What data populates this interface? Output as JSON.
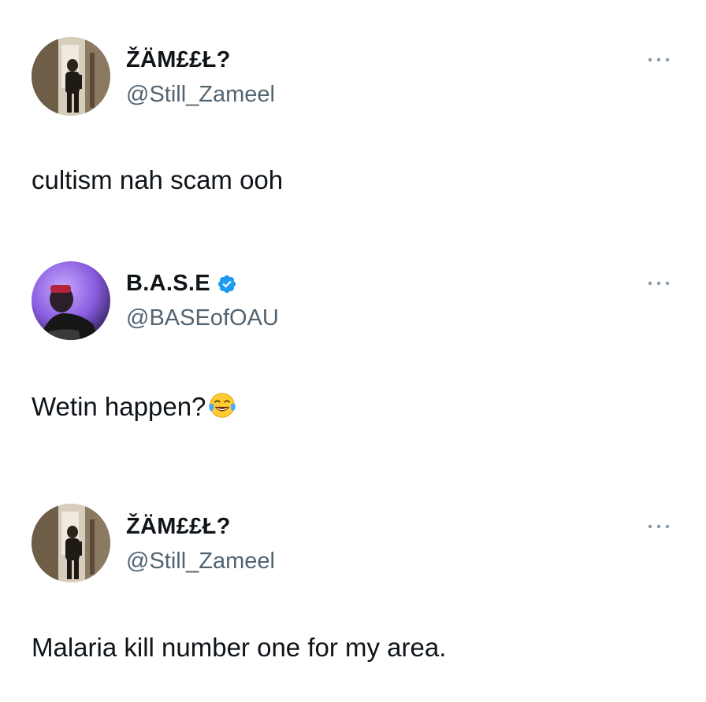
{
  "tweets": [
    {
      "display_name": "ŽÄM£££?",
      "display_name_exact": "ŽÄM££Ł?",
      "handle": "@Still_Zameel",
      "verified": false,
      "text": "cultism nah scam ooh",
      "emoji": "",
      "avatar": "photo-avatar-hallway",
      "more_icon": "more-horizontal-icon"
    },
    {
      "display_name": "B.A.S.E",
      "handle": "@BASEofOAU",
      "verified": true,
      "text": "Wetin happen?",
      "emoji": "😂",
      "avatar": "photo-avatar-purple",
      "more_icon": "more-horizontal-icon"
    },
    {
      "display_name": "ŽÄM££Ł?",
      "handle": "@Still_Zameel",
      "verified": false,
      "text": "Malaria kill number one for my area.",
      "emoji": "",
      "avatar": "photo-avatar-hallway",
      "more_icon": "more-horizontal-icon"
    }
  ],
  "colors": {
    "text_primary": "#0f1419",
    "text_secondary": "#536471",
    "verified_blue": "#1d9bf0",
    "more_dots": "#8b98a5"
  }
}
